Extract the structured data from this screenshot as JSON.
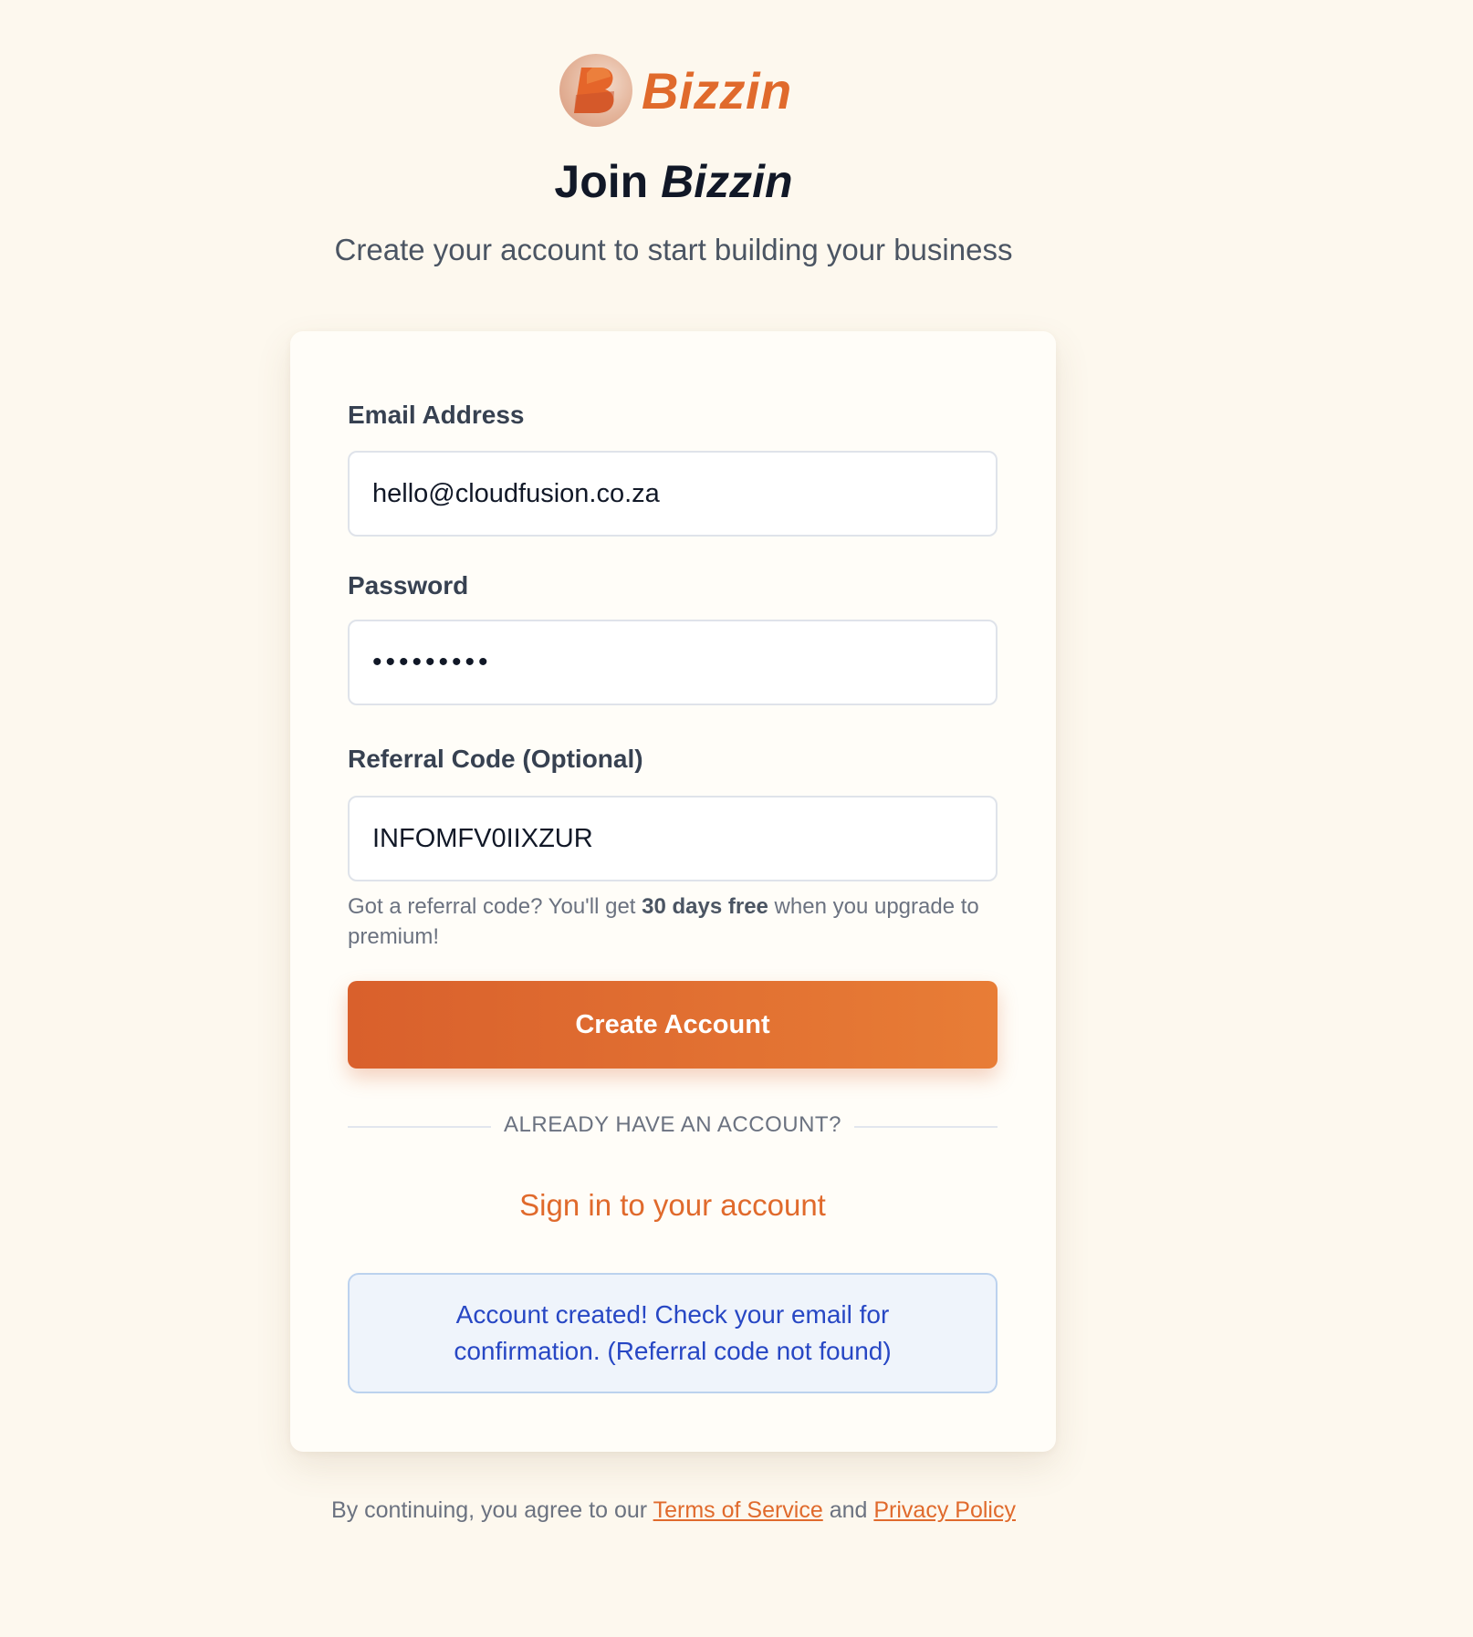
{
  "brand": {
    "name": "Bizzin",
    "logo_icon": "b-logo-icon",
    "color": "#e06a2c"
  },
  "header": {
    "title_prefix": "Join",
    "title_brand": "Bizzin",
    "subtitle": "Create your account to start building your business"
  },
  "form": {
    "email": {
      "label": "Email Address",
      "value": "hello@cloudfusion.co.za"
    },
    "password": {
      "label": "Password",
      "value": "•••••••••"
    },
    "referral": {
      "label": "Referral Code (Optional)",
      "value": "INFOMFV0IIXZUR"
    },
    "hint": {
      "before": "Got a referral code? You'll get ",
      "bold": "30 days free",
      "after": " when you upgrade to premium!"
    },
    "submit_label": "Create Account"
  },
  "divider": {
    "text": "ALREADY HAVE AN ACCOUNT?"
  },
  "signin": {
    "label": "Sign in to your account"
  },
  "alert": {
    "message": "Account created! Check your email for confirmation. (Referral code not found)"
  },
  "footer": {
    "prefix": "By continuing, you agree to our ",
    "terms": "Terms of Service",
    "and": " and ",
    "privacy": "Privacy Policy"
  },
  "colors": {
    "background": "#fdf8ee",
    "accent": "#e06a2c",
    "alert_text": "#2747c4",
    "alert_bg": "#eff4fb"
  }
}
